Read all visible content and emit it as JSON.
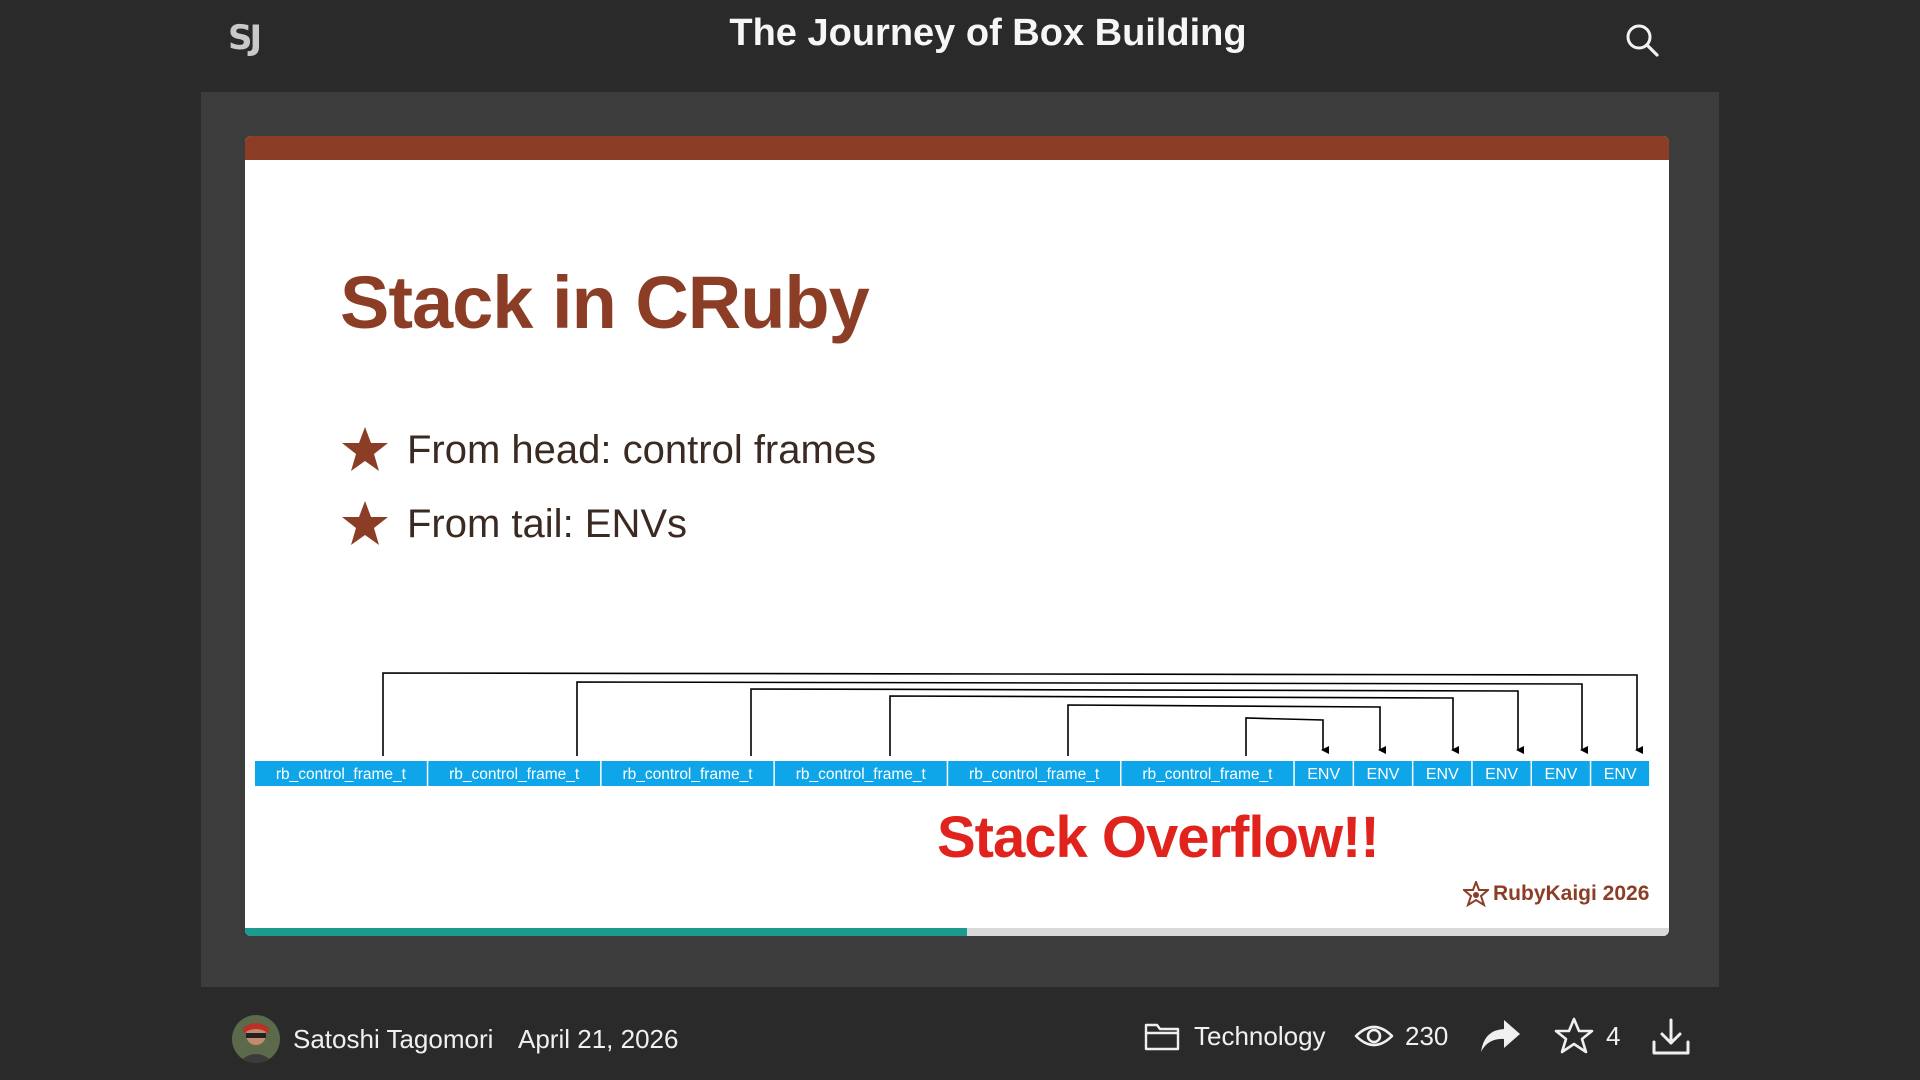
{
  "header": {
    "logo_text": "SJ",
    "deck_title": "The Journey of Box Building"
  },
  "slide": {
    "title": "Stack in CRuby",
    "bullets": [
      {
        "text": "From head: control frames"
      },
      {
        "text": "From tail: ENVs"
      }
    ],
    "frames": [
      "rb_control_frame_t",
      "rb_control_frame_t",
      "rb_control_frame_t",
      "rb_control_frame_t",
      "rb_control_frame_t",
      "rb_control_frame_t",
      "ENV",
      "ENV",
      "ENV",
      "ENV",
      "ENV",
      "ENV"
    ],
    "overflow_message": "Stack Overflow!!",
    "event_badge": "RubyKaigi 2026",
    "colors": {
      "accent": "#8b3e25",
      "frame_cell": "#0ea5e9",
      "overflow": "#e0241d",
      "progress": "#1a9b8e"
    }
  },
  "progress": {
    "fraction": 0.507
  },
  "footer": {
    "author": "Satoshi Tagomori",
    "date": "April 21, 2026",
    "category": "Technology",
    "views": "230",
    "stars": "4",
    "icons": [
      "folder-icon",
      "eye-icon",
      "share-icon",
      "star-outline-icon",
      "download-icon",
      "search-icon"
    ]
  }
}
